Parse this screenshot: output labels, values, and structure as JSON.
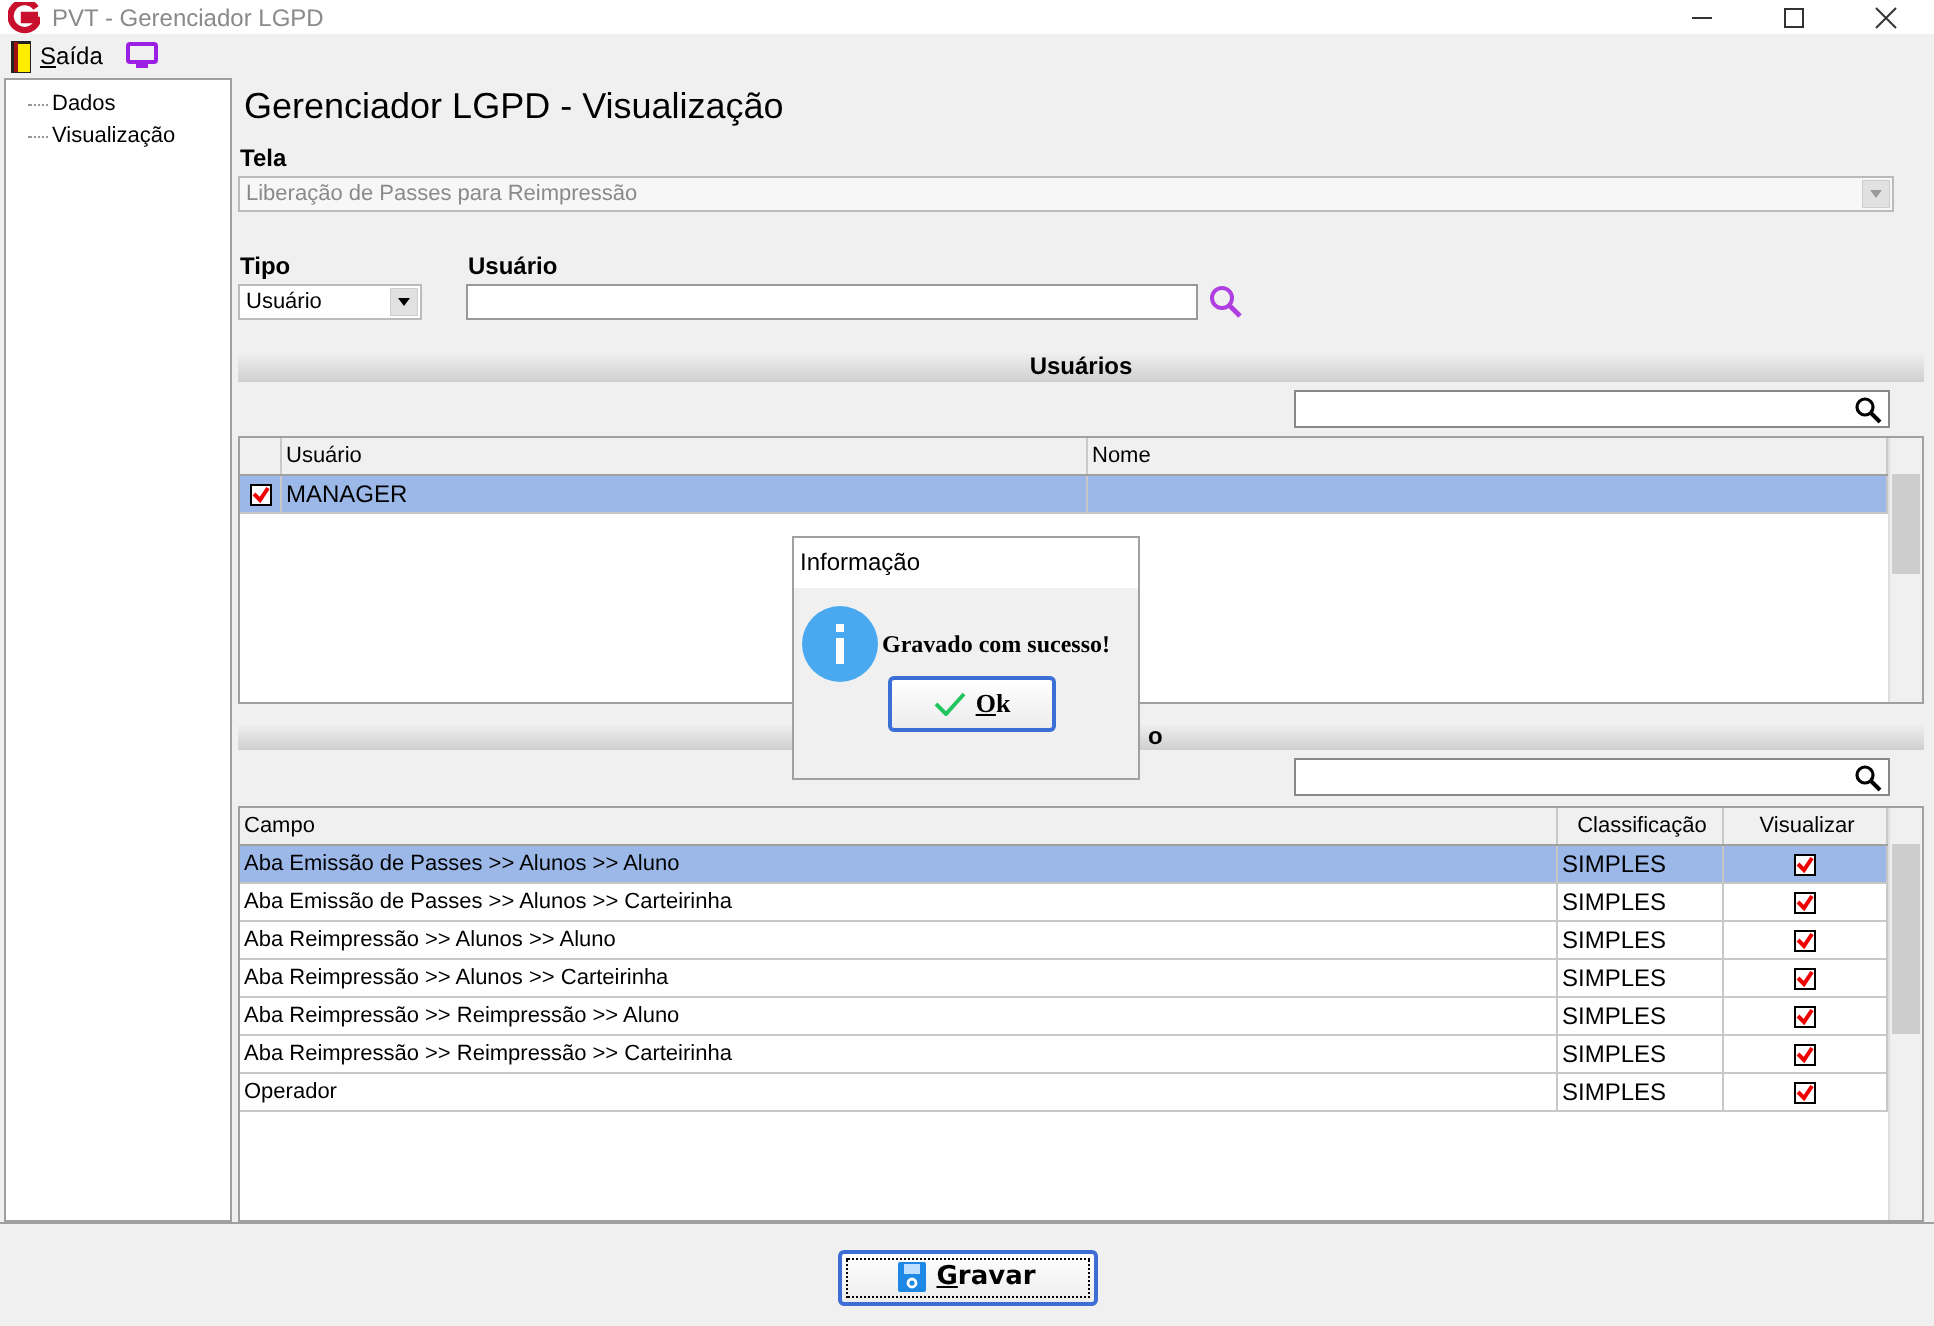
{
  "window": {
    "title": "PVT - Gerenciador LGPD"
  },
  "menu": [
    {
      "label": "Saída"
    }
  ],
  "tree": [
    {
      "label": "Dados"
    },
    {
      "label": "Visualização"
    }
  ],
  "page_title": "Gerenciador LGPD - Visualização",
  "tela": {
    "label": "Tela",
    "value": "Liberação de Passes para Reimpressão",
    "disabled": true
  },
  "tipo": {
    "label": "Tipo",
    "value": "Usuário"
  },
  "usuario": {
    "label": "Usuário"
  },
  "users_section": {
    "title": "Usuários",
    "columns": [
      "Usuário",
      "Nome"
    ],
    "rows": [
      {
        "checked": true,
        "usuario": "MANAGER",
        "selected": true
      }
    ]
  },
  "fields_section": {
    "title": "o",
    "columns": [
      "Campo",
      "Classificação",
      "Visualizar"
    ],
    "rows": [
      {
        "campo": "Aba Emissão de Passes >> Alunos >> Aluno",
        "classificacao": "SIMPLES",
        "visualizar": true,
        "selected": true
      },
      {
        "campo": "Aba Emissão de Passes >> Alunos >> Carteirinha",
        "classificacao": "SIMPLES",
        "visualizar": true,
        "selected": false
      },
      {
        "campo": "Aba Reimpressão >> Alunos >> Aluno",
        "classificacao": "SIMPLES",
        "visualizar": true,
        "selected": false
      },
      {
        "campo": "Aba Reimpressão >> Alunos >> Carteirinha",
        "classificacao": "SIMPLES",
        "visualizar": true,
        "selected": false
      },
      {
        "campo": "Aba Reimpressão >> Reimpressão >> Aluno",
        "classificacao": "SIMPLES",
        "visualizar": true,
        "selected": false
      },
      {
        "campo": "Aba Reimpressão >> Reimpressão >> Carteirinha",
        "classificacao": "SIMPLES",
        "visualizar": true,
        "selected": false
      },
      {
        "campo": "Operador",
        "classificacao": "SIMPLES",
        "visualizar": true,
        "selected": false
      }
    ]
  },
  "dialog": {
    "title": "Informação",
    "message": "Gravado com sucesso!",
    "button": "Ok"
  },
  "save_button": "Gravar"
}
